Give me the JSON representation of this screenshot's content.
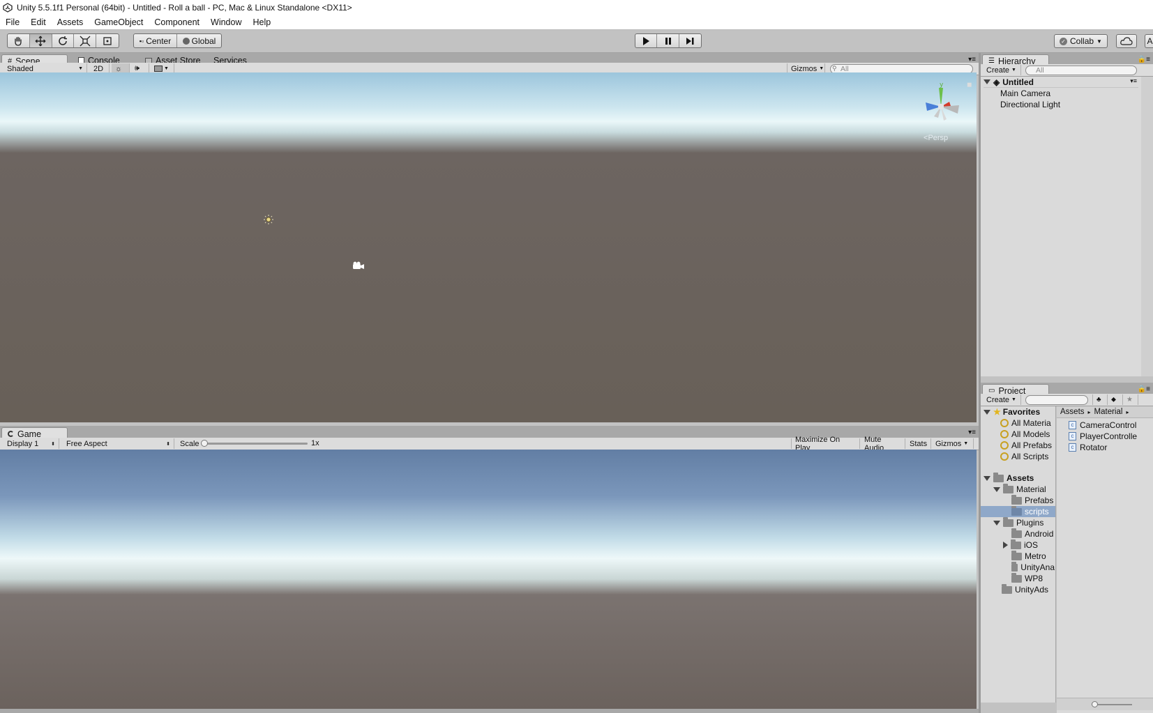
{
  "window": {
    "title": "Unity 5.5.1f1 Personal (64bit) - Untitled - Roll a ball - PC, Mac & Linux Standalone <DX11>"
  },
  "menu": [
    "File",
    "Edit",
    "Assets",
    "GameObject",
    "Component",
    "Window",
    "Help"
  ],
  "toolbar": {
    "pivot_label": "Center",
    "space_label": "Global",
    "collab_label": "Collab",
    "account_label": "A"
  },
  "scene_panel": {
    "tabs": [
      "Scene",
      "Console",
      "Asset Store",
      "Services"
    ],
    "shading": "Shaded",
    "mode_2d": "2D",
    "gizmos": "Gizmos",
    "search_placeholder": "All",
    "persp_label": "Persp",
    "gizmo_axis_y": "y"
  },
  "game_panel": {
    "tab": "Game",
    "display": "Display 1",
    "aspect": "Free Aspect",
    "scale_label": "Scale",
    "scale_value": "1x",
    "scale_level": 0.0,
    "maximize": "Maximize On Play",
    "mute": "Mute Audio",
    "stats": "Stats",
    "gizmos": "Gizmos"
  },
  "hierarchy": {
    "tab": "Hierarchy",
    "create": "Create",
    "search_placeholder": "All",
    "scene_name": "Untitled",
    "items": [
      "Main Camera",
      "Directional Light"
    ]
  },
  "project": {
    "tab": "Project",
    "create": "Create",
    "favorites_label": "Favorites",
    "favorites": [
      "All Materia",
      "All Models",
      "All Prefabs",
      "All Scripts"
    ],
    "assets_label": "Assets",
    "tree": {
      "material": "Material",
      "prefabs": "Prefabs",
      "scripts": "scripts",
      "plugins": "Plugins",
      "android": "Android",
      "ios": "iOS",
      "metro": "Metro",
      "unityana": "UnityAna",
      "wp8": "WP8",
      "unityads": "UnityAds"
    },
    "breadcrumb": [
      "Assets",
      "Material"
    ],
    "files": [
      "CameraControl",
      "PlayerControlle",
      "Rotator"
    ],
    "zoom_level": 0.0
  },
  "colors": {
    "accent_selected": "#8fa8c9",
    "hierarchy_bg": "#dadada",
    "toolbar_bg": "#c2c2c2"
  }
}
